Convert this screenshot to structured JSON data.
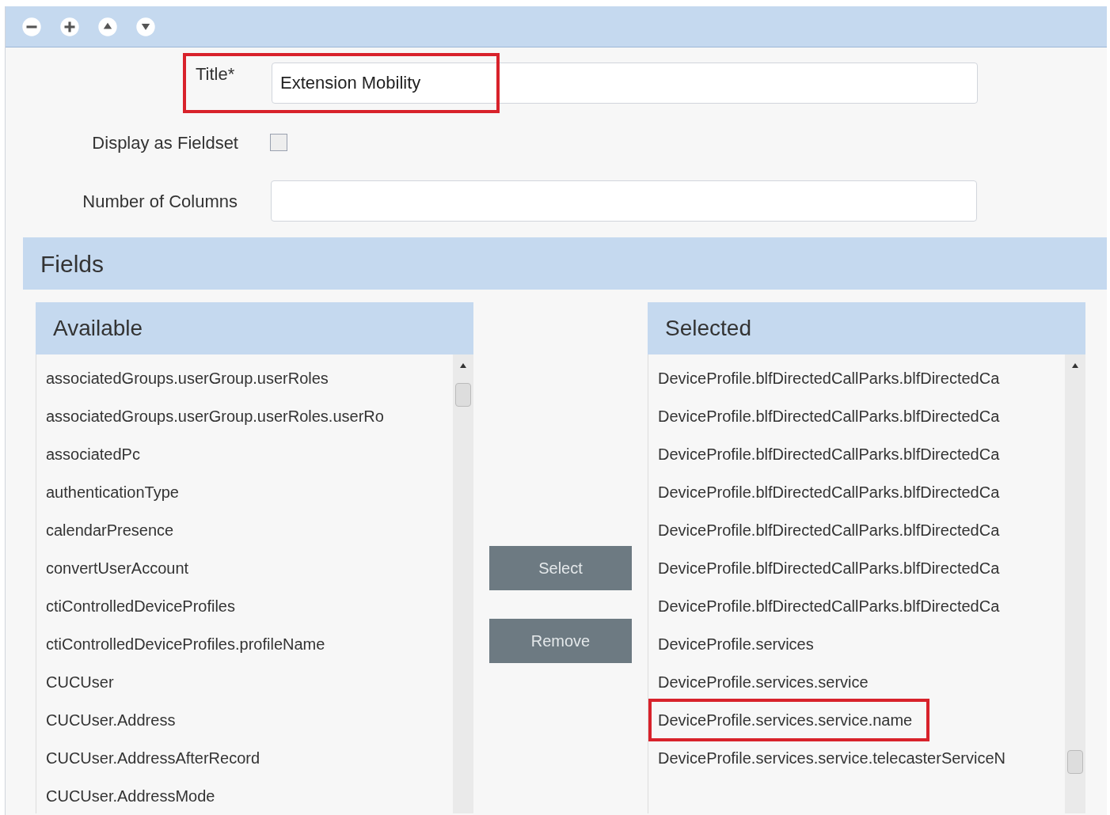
{
  "toolbar": {
    "buttons": [
      {
        "kind": "collapse"
      },
      {
        "kind": "add"
      },
      {
        "kind": "up"
      },
      {
        "kind": "down"
      }
    ]
  },
  "form": {
    "title": {
      "label": "Title*",
      "value": "Extension Mobility",
      "highlighted": true
    },
    "display_as_fieldset": {
      "label": "Display as Fieldset",
      "checked": false
    },
    "number_of_columns": {
      "label": "Number of Columns"
    }
  },
  "fields": {
    "heading": "Fields",
    "available": {
      "heading": "Available",
      "items": [
        {
          "text": "associatedGroups.userGroup.userRoles",
          "highlighted": false
        },
        {
          "text": "associatedGroups.userGroup.userRoles.userRo",
          "highlighted": false
        },
        {
          "text": "associatedPc",
          "highlighted": false
        },
        {
          "text": "authenticationType",
          "highlighted": false
        },
        {
          "text": "calendarPresence",
          "highlighted": false
        },
        {
          "text": "convertUserAccount",
          "highlighted": false
        },
        {
          "text": "ctiControlledDeviceProfiles",
          "highlighted": false
        },
        {
          "text": "ctiControlledDeviceProfiles.profileName",
          "highlighted": false
        },
        {
          "text": "CUCUser",
          "highlighted": false
        },
        {
          "text": "CUCUser.Address",
          "highlighted": false
        },
        {
          "text": "CUCUser.AddressAfterRecord",
          "highlighted": false
        },
        {
          "text": "CUCUser.AddressMode",
          "highlighted": false
        }
      ]
    },
    "buttons": [
      "Select",
      "Remove"
    ],
    "selected": {
      "heading": "Selected",
      "items": [
        {
          "text": "DeviceProfile.blfDirectedCallParks.blfDirectedCa",
          "highlighted": false
        },
        {
          "text": "DeviceProfile.blfDirectedCallParks.blfDirectedCa",
          "highlighted": false
        },
        {
          "text": "DeviceProfile.blfDirectedCallParks.blfDirectedCa",
          "highlighted": false
        },
        {
          "text": "DeviceProfile.blfDirectedCallParks.blfDirectedCa",
          "highlighted": false
        },
        {
          "text": "DeviceProfile.blfDirectedCallParks.blfDirectedCa",
          "highlighted": false
        },
        {
          "text": "DeviceProfile.blfDirectedCallParks.blfDirectedCa",
          "highlighted": false
        },
        {
          "text": "DeviceProfile.blfDirectedCallParks.blfDirectedCa",
          "highlighted": false
        },
        {
          "text": "DeviceProfile.services",
          "highlighted": false
        },
        {
          "text": "DeviceProfile.services.service",
          "highlighted": false
        },
        {
          "text": "DeviceProfile.services.service.name",
          "highlighted": true
        },
        {
          "text": "DeviceProfile.services.service.telecasterServiceN",
          "highlighted": false
        }
      ]
    }
  }
}
